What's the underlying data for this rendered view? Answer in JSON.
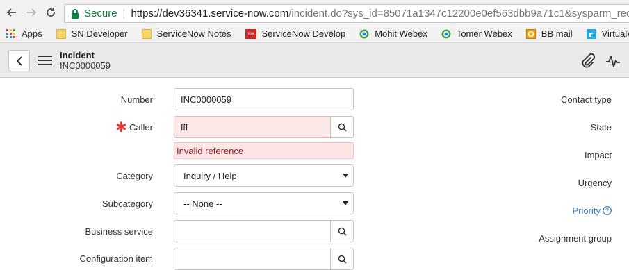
{
  "browser": {
    "secure_label": "Secure",
    "url_host": "https://dev36341.service-now.com",
    "url_path": "/incident.do?sys_id=85071a1347c12200e0ef563dbb9a71c1&sysparm_record_target"
  },
  "bookmarks": {
    "items": [
      {
        "label": "Apps"
      },
      {
        "label": "SN Developer"
      },
      {
        "label": "ServiceNow Notes"
      },
      {
        "label": "ServiceNow Develop"
      },
      {
        "label": "Mohit Webex"
      },
      {
        "label": "Tomer Webex"
      },
      {
        "label": "BB mail"
      },
      {
        "label": "VirtualWorks™"
      }
    ],
    "now_badge": "now"
  },
  "header": {
    "title": "Incident",
    "record_number": "INC0000059"
  },
  "form": {
    "number": {
      "label": "Number",
      "value": "INC0000059"
    },
    "caller": {
      "label": "Caller",
      "value": "fff",
      "error": "Invalid reference"
    },
    "category": {
      "label": "Category",
      "value": "Inquiry / Help"
    },
    "subcategory": {
      "label": "Subcategory",
      "value": "-- None --"
    },
    "business_service": {
      "label": "Business service",
      "value": ""
    },
    "configuration_item": {
      "label": "Configuration item",
      "value": ""
    }
  },
  "right_column": {
    "contact_type": "Contact type",
    "state": "State",
    "impact": "Impact",
    "urgency": "Urgency",
    "priority": "Priority",
    "assignment_group": "Assignment group"
  },
  "colors": {
    "secure_green": "#0b8043",
    "error_red": "#e53935",
    "link_blue": "#3a75c4"
  }
}
